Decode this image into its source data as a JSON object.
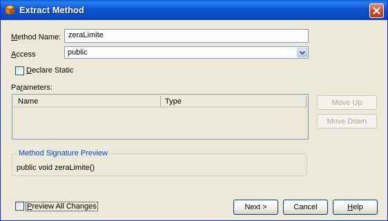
{
  "window": {
    "title": "Extract Method"
  },
  "form": {
    "method_name_label": "Method Name:",
    "method_name_value": "zeraLimite",
    "access_label": "Access",
    "access_value": "public",
    "declare_static_label": "Declare Static",
    "declare_static_checked": false,
    "parameters_label": "Parameters:"
  },
  "parameters_table": {
    "columns": [
      "Name",
      "Type"
    ],
    "rows": []
  },
  "buttons": {
    "move_up": "Move Up",
    "move_down": "Move Down",
    "next": "Next >",
    "cancel": "Cancel",
    "help": "Help"
  },
  "signature_preview": {
    "legend": "Method Signature Preview",
    "text": "public void zeraLimite()"
  },
  "footer": {
    "preview_all_changes_label": "Preview All Changes",
    "preview_all_changes_checked": false
  },
  "icons": {
    "app": "netbeans-cube-icon",
    "close": "close-icon",
    "dropdown": "chevron-down-icon"
  },
  "colors": {
    "titlebar": "#0a5fd6",
    "window_bg": "#ece9d8",
    "group_legend": "#0046d5",
    "close_button": "#d7492c"
  }
}
